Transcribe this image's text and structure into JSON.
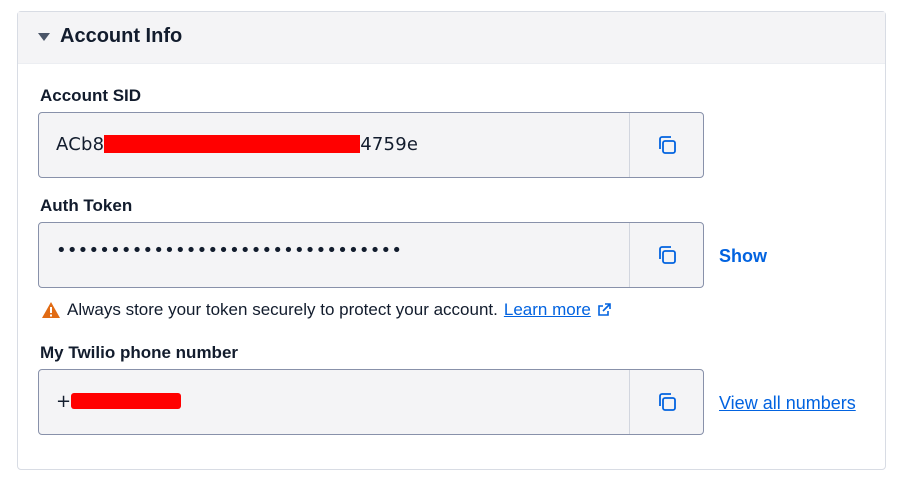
{
  "section": {
    "title": "Account Info",
    "caret_icon": "caret-down-icon"
  },
  "account_sid": {
    "label": "Account SID",
    "value_prefix": "ACb8",
    "value_suffix": "4759e",
    "redacted": true,
    "copy_icon": "copy-icon"
  },
  "auth_token": {
    "label": "Auth Token",
    "masked_value": "••••••••••••••••••••••••••••••••",
    "copy_icon": "copy-icon",
    "show_label": "Show"
  },
  "warning": {
    "icon": "warning-triangle-icon",
    "text": "Always store your token securely to protect your account.",
    "link_label": "Learn more",
    "link_icon": "external-link-icon"
  },
  "phone": {
    "label": "My Twilio phone number",
    "value_prefix": "+",
    "redacted": true,
    "copy_icon": "copy-icon",
    "view_all_label": "View all numbers"
  },
  "colors": {
    "link": "#0263e0",
    "warning": "#e16b14",
    "redaction": "#ff0000",
    "field_bg": "#f4f4f6",
    "field_border": "#8891aa"
  }
}
